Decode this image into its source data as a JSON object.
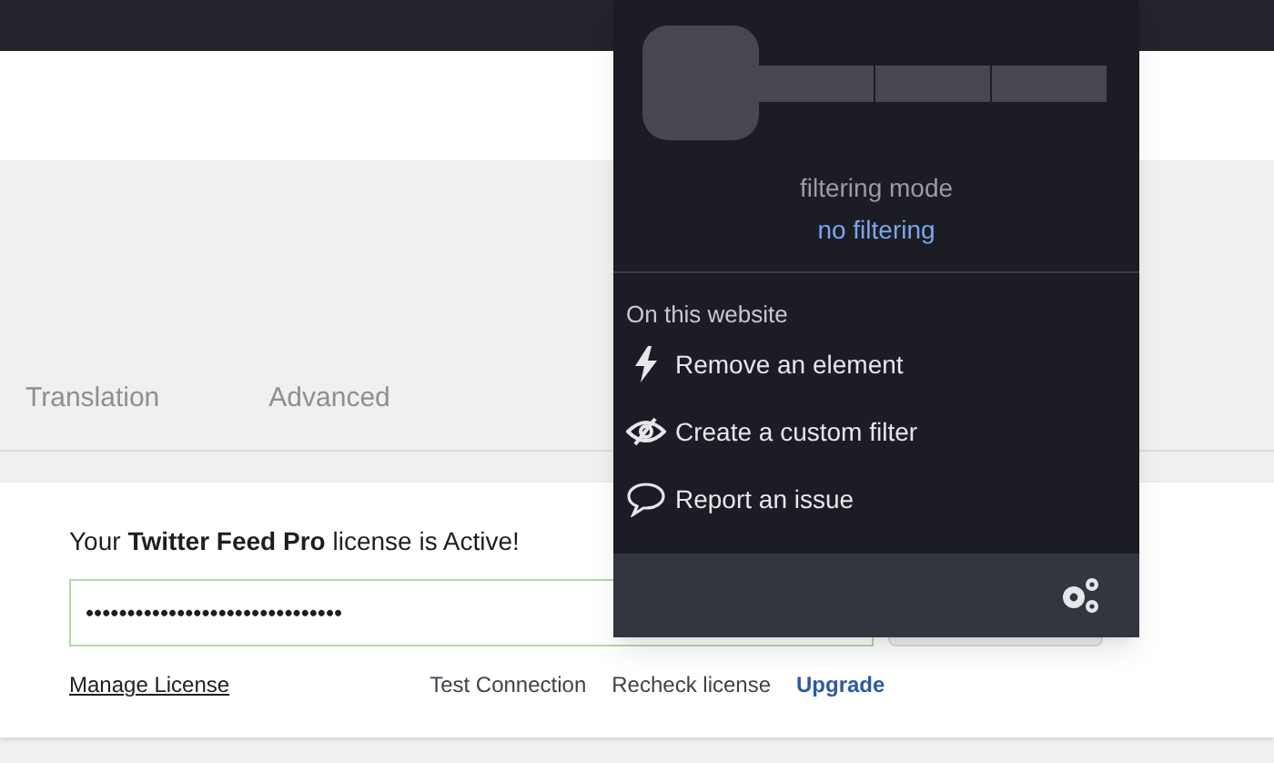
{
  "tabs": [
    {
      "label": "Translation"
    },
    {
      "label": "Advanced"
    }
  ],
  "license": {
    "message": "Your **Twitter Feed Pro** license is Active!",
    "field_value": "•••••••••••••••••••••••••••••••",
    "links": [
      {
        "label": "Manage License",
        "kind": "underline"
      },
      {
        "label": "Test Connection",
        "kind": "plain"
      },
      {
        "label": "Recheck license",
        "kind": "plain"
      },
      {
        "label": "Upgrade",
        "kind": "accent"
      }
    ]
  },
  "popup": {
    "mode_label": "filtering mode",
    "mode_value": "no filtering",
    "section_title": "On this website",
    "actions": [
      {
        "label": "Remove an element",
        "kind": "bolt"
      },
      {
        "label": "Create a custom filter",
        "kind": "eye"
      },
      {
        "label": "Report an issue",
        "kind": "speech"
      }
    ]
  }
}
